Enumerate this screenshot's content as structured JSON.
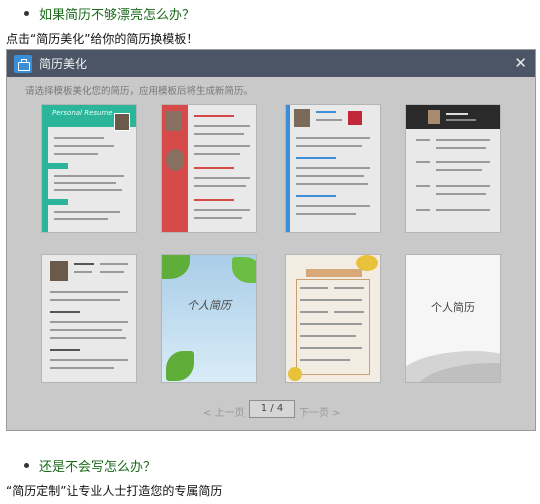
{
  "article": {
    "q1": "如果简历不够漂亮怎么办？",
    "line1": "点击“简历美化”给你的简历换模板！",
    "q2": "还是不会写怎么办？",
    "line2": "“简历定制”让专业人士打造您的专属简历"
  },
  "dialog": {
    "title": "简历美化",
    "close": "✕",
    "hint": "请选择模板美化您的简历，应用模板后将生成新简历。",
    "templates": [
      {
        "label": "Personal Resume"
      },
      {
        "label": ""
      },
      {
        "label": ""
      },
      {
        "label": ""
      },
      {
        "label": ""
      },
      {
        "label": "个人简历"
      },
      {
        "label": ""
      },
      {
        "label": "个人简历"
      }
    ],
    "pager": {
      "prev": "< 上一页",
      "page": "1 / 4",
      "next": "下一页 >"
    }
  },
  "colors": {
    "question": "#1a6a1a",
    "titlebar": "#4b5565",
    "accent_teal": "#2bb59a",
    "accent_red": "#d64a4a",
    "accent_blue": "#3b8fd6"
  }
}
